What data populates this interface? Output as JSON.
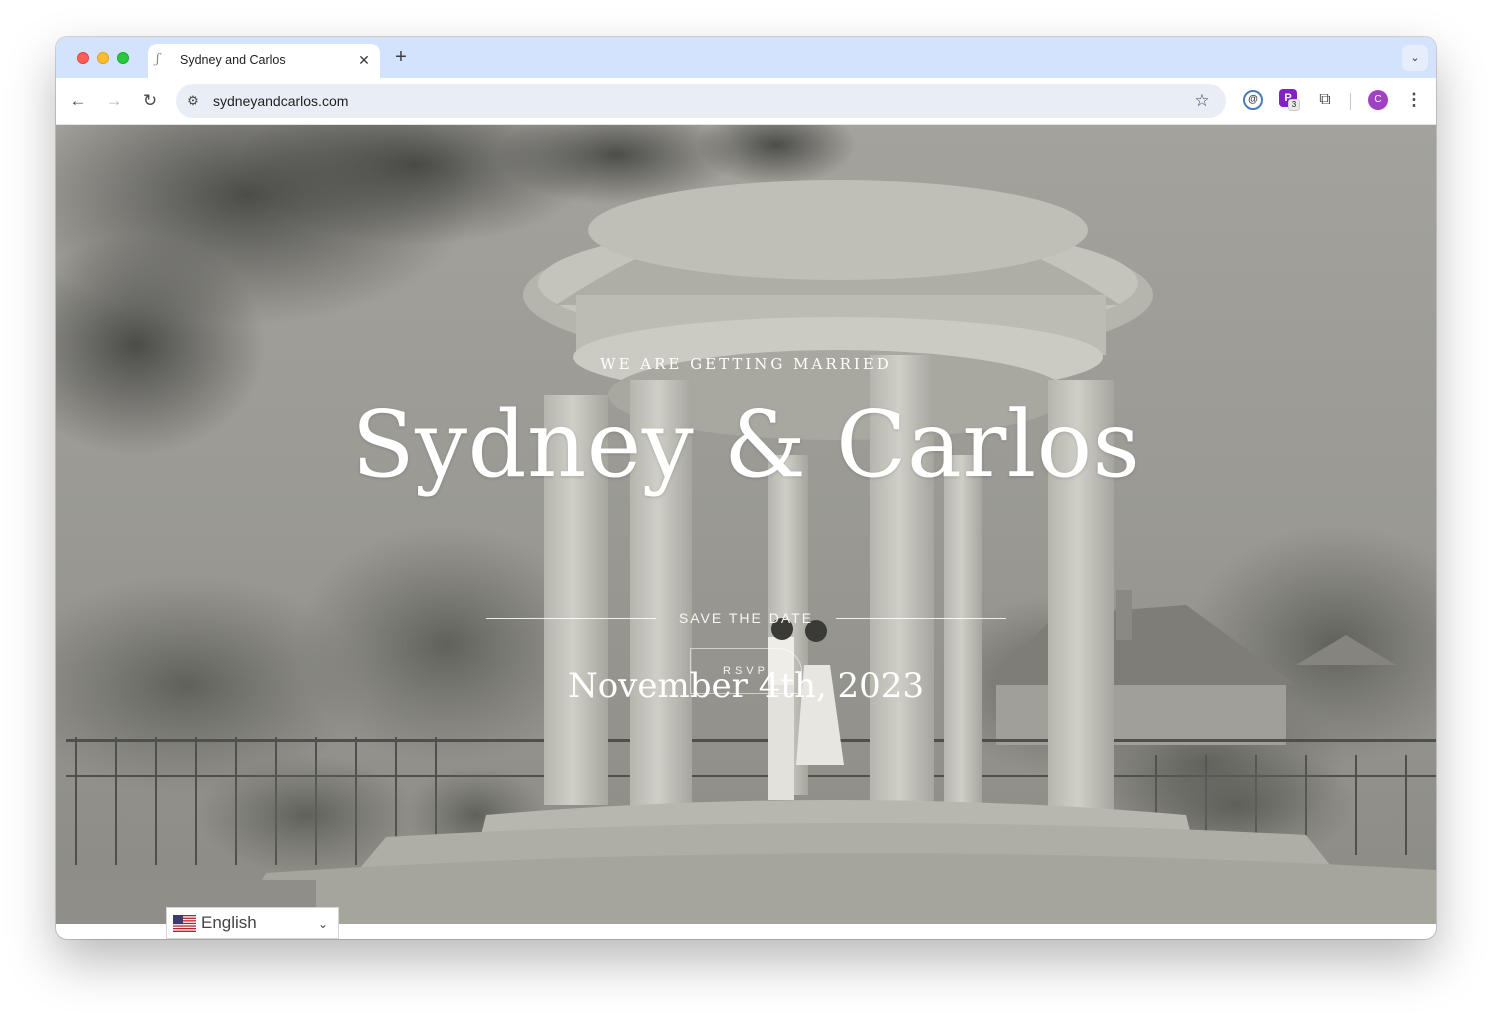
{
  "browser": {
    "tab": {
      "title": "Sydney and Carlos",
      "favicon": "monogram-icon",
      "close_glyph": "✕"
    },
    "new_tab_glyph": "+",
    "tab_search_glyph": "⌄",
    "toolbar": {
      "back_glyph": "←",
      "forward_glyph": "→",
      "reload_glyph": "↻",
      "url": "sydneyandcarlos.com",
      "site_info_glyph": "⚙",
      "bookmark_glyph": "☆",
      "ext_b_badge": "3",
      "ext_b_letter": "P",
      "puzzle_glyph": "⧉",
      "profile_initial": "C",
      "menu_glyph": "⋮"
    }
  },
  "hero": {
    "kicker": "WE ARE GETTING MARRIED",
    "names": "Sydney & Carlos",
    "save_the_date": "SAVE THE DATE",
    "date": "November 4th, 2023",
    "rsvp_label": "RSVP"
  },
  "language": {
    "selected": "English",
    "chevron": "⌄"
  },
  "colors": {
    "tabstrip": "#d3e3fd",
    "omnibox": "#e9eef6",
    "hero_overlay": "#8e8d87",
    "profile": "#a142c4",
    "extension_purple": "#8420c6"
  }
}
